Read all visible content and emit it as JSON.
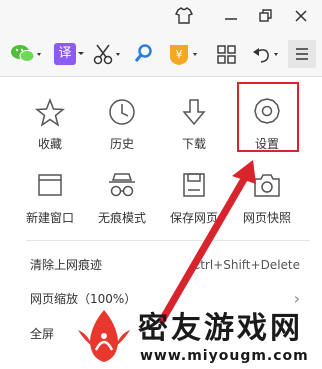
{
  "colors": {
    "accent_red": "#d9232d",
    "icon_gray": "#555555",
    "wm_red": "#e8372d"
  },
  "menu": {
    "grid": [
      {
        "label": "收藏",
        "icon": "star-icon"
      },
      {
        "label": "历史",
        "icon": "clock-icon"
      },
      {
        "label": "下载",
        "icon": "download-icon"
      },
      {
        "label": "设置",
        "icon": "gear-icon"
      },
      {
        "label": "新建窗口",
        "icon": "new-window-icon"
      },
      {
        "label": "无痕模式",
        "icon": "incognito-icon"
      },
      {
        "label": "保存网页",
        "icon": "save-page-icon"
      },
      {
        "label": "网页快照",
        "icon": "camera-icon"
      }
    ],
    "rows": [
      {
        "label": "清除上网痕迹",
        "shortcut": "Ctrl+Shift+Delete"
      },
      {
        "label": "网页缩放（100%）",
        "arrow": "›"
      },
      {
        "label": "全屏"
      }
    ]
  },
  "toolbar": {
    "translate_label": "译"
  },
  "watermark": {
    "title": "密友游戏网",
    "url": "www.miyougm.com"
  }
}
